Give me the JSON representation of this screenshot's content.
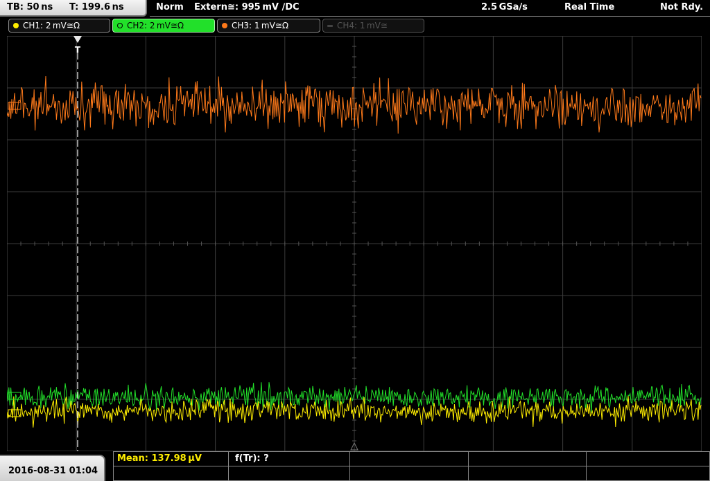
{
  "header": {
    "timebase": "TB: 50 ns",
    "trigger_time": "T: 199.6 ns",
    "trigger_mode": "Norm",
    "trigger_source": "Extern≅: 995 mV ∕DC",
    "sample_rate": "2.5 GSa/s",
    "acquisition_mode": "Real Time",
    "status": "Not Rdy."
  },
  "channels": [
    {
      "label": "CH1: 2 mV≅Ω",
      "color": "#ffee00",
      "active": true
    },
    {
      "label": "CH2: 2 mV≅Ω",
      "color": "#22e02a",
      "active": true,
      "selected": true
    },
    {
      "label": "CH3: 1 mV≅Ω",
      "color": "#ff7a1a",
      "active": true
    },
    {
      "label": "CH4: 1 mV≅",
      "color": "#555555",
      "active": false
    }
  ],
  "footer": {
    "datetime": "2016-08-31 01:04",
    "mean_label": "Mean: 137.98 μV",
    "freq_label": "f(Tr): ?"
  },
  "markers": {
    "trigger_marker": "T"
  },
  "colors": {
    "grid": "#3c3c3c",
    "background": "#000000",
    "ch1": "#ffee00",
    "ch2": "#22e02a",
    "ch3": "#ff7a1a",
    "measure_text": "#ffee00"
  }
}
